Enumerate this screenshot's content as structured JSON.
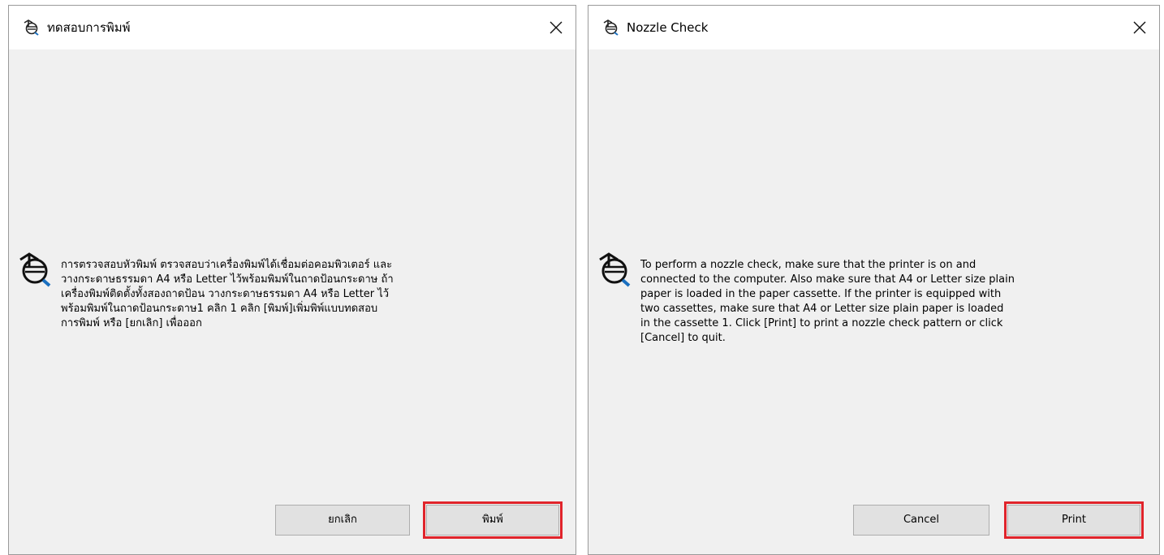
{
  "dialogs": {
    "thai": {
      "title": "ทดสอบการพิมพ์",
      "message_lines": [
        "การตรวจสอบหัวพิมพ์ ตรวจสอบว่าเครื่องพิมพ์ได้เชื่อมต่อคอมพิวเตอร์ และ",
        "วางกระดาษธรรมดา A4 หรือ Letter ไว้พร้อมพิมพ์ในถาดป้อนกระดาษ ถ้า",
        "เครื่องพิมพ์ติดตั้งทั้งสองถาดป้อน วางกระดาษธรรมดา A4 หรือ Letter ไว้",
        "พร้อมพิมพ์ในถาดป้อนกระดาษ1 คลิก 1 คลิก [พิมพ์]เพิ่มพิพ์แบบทดสอบ",
        "การพิมพ์ หรือ [ยกเลิก] เพื่อออก"
      ],
      "cancel_label": "ยกเลิก",
      "print_label": "พิมพ์"
    },
    "english": {
      "title": "Nozzle Check",
      "message_lines": [
        "To perform a nozzle check, make sure that the printer is on and",
        "connected to the computer. Also make sure that A4 or Letter size plain",
        "paper is loaded in the paper cassette. If the printer is equipped with",
        "two cassettes, make sure that A4 or Letter size plain paper is loaded",
        "in the cassette 1. Click [Print] to print a nozzle check pattern or click",
        "[Cancel] to quit."
      ],
      "cancel_label": "Cancel",
      "print_label": "Print"
    }
  },
  "icons": {
    "app": "nozzle-check-app-icon",
    "message": "nozzle-check-info-icon",
    "close": "close-icon"
  },
  "colors": {
    "dialog_body": "#f0f0f0",
    "button_face": "#e1e1e1",
    "highlight": "#e0242b"
  }
}
